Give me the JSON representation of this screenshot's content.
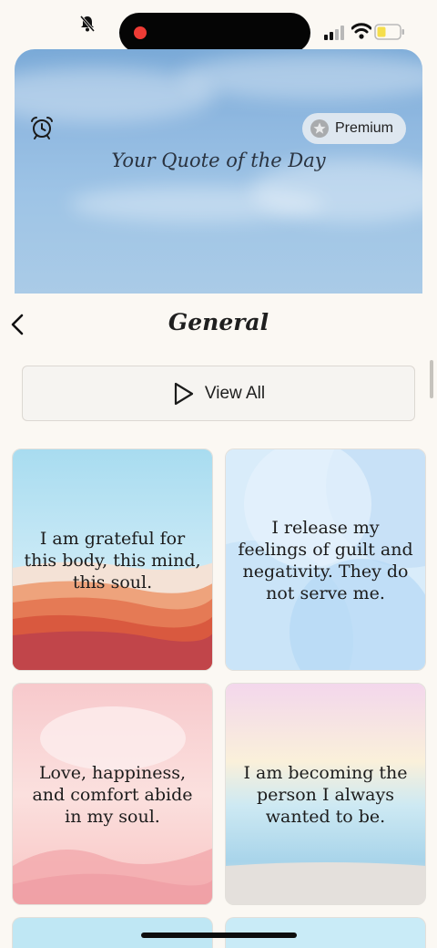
{
  "hero": {
    "title": "Your Quote of the Day",
    "premium_label": "Premium"
  },
  "nav": {
    "title": "General"
  },
  "view_all": {
    "label": "View All"
  },
  "cards": [
    {
      "quote": "I am grateful for this body, this mind, this soul."
    },
    {
      "quote": "I release my feelings of guilt and negativity. They do not serve me."
    },
    {
      "quote": "Love, happiness, and comfort abide in my soul."
    },
    {
      "quote": "I am becoming the person I always wanted to be."
    }
  ],
  "colors": {
    "background": "#fbf8f3",
    "record_dot": "#ee3b35",
    "battery_fill": "#f5de4c"
  },
  "icons": [
    "bell-slash-icon",
    "signal-icon",
    "wifi-icon",
    "battery-icon",
    "alarm-clock-icon",
    "star-icon",
    "chevron-left-icon",
    "play-icon"
  ]
}
